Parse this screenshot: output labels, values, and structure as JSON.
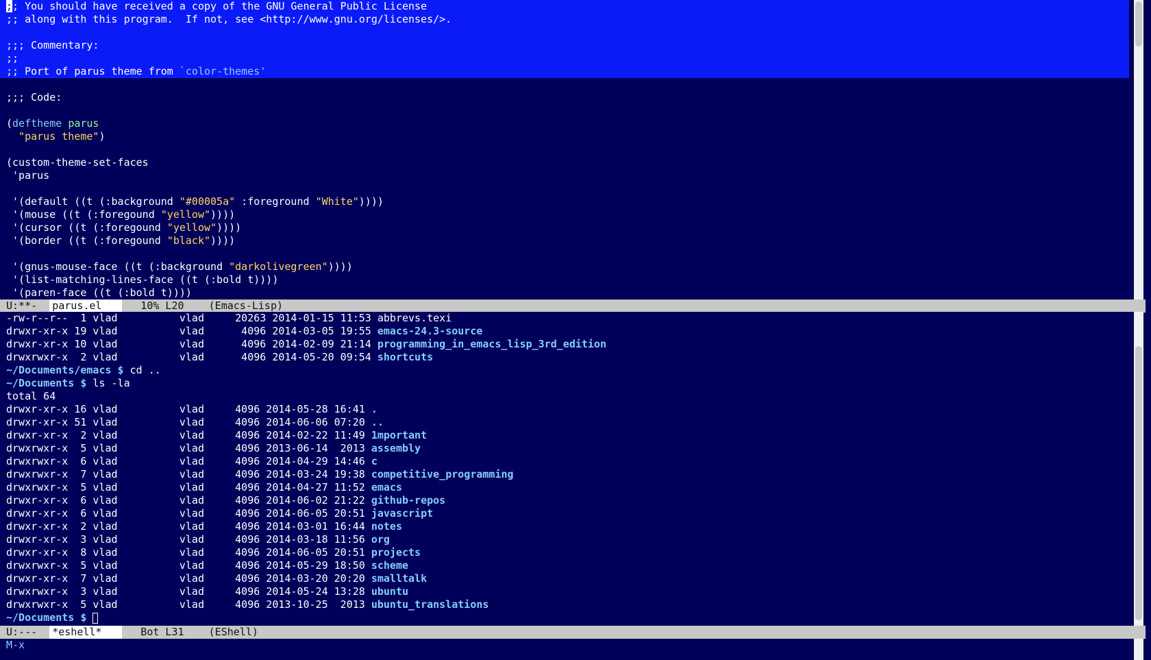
{
  "editor": {
    "comment_lines": [
      ";; You should have received a copy of the GNU General Public License",
      ";; along with this program.  If not, see <http://www.gnu.org/licenses/>.",
      "",
      ";;; Commentary:",
      ";;",
      ";; Port of parus theme from `color-themes'"
    ],
    "code_header": ";;; Code:",
    "deftheme_kw": "deftheme",
    "deftheme_name": "parus",
    "deftheme_doc": "\"parus theme\"",
    "custom_fn": "(custom-theme-set-faces",
    "custom_arg": " 'parus",
    "faces": [
      {
        "prefix": " '(default ((t (:background ",
        "s1": "\"#00005a\"",
        "mid": " :foreground ",
        "s2": "\"White\"",
        "suffix": "))))"
      },
      {
        "prefix": " '(mouse ((t (:foregound ",
        "s1": "\"yellow\"",
        "mid": "",
        "s2": "",
        "suffix": "))))"
      },
      {
        "prefix": " '(cursor ((t (:foregound ",
        "s1": "\"yellow\"",
        "mid": "",
        "s2": "",
        "suffix": "))))"
      },
      {
        "prefix": " '(border ((t (:foregound ",
        "s1": "\"black\"",
        "mid": "",
        "s2": "",
        "suffix": "))))"
      },
      {
        "prefix": "",
        "s1": "",
        "mid": "",
        "s2": "",
        "suffix": ""
      },
      {
        "prefix": " '(gnus-mouse-face ((t (:background ",
        "s1": "\"darkolivegreen\"",
        "mid": "",
        "s2": "",
        "suffix": "))))"
      },
      {
        "prefix": " '(list-matching-lines-face ((t (:bold t))))",
        "s1": "",
        "mid": "",
        "s2": "",
        "suffix": ""
      },
      {
        "prefix": " '(paren-face ((t (:bold t))))",
        "s1": "",
        "mid": "",
        "s2": "",
        "suffix": ""
      }
    ]
  },
  "modeline_top": {
    "status": "U:**-  ",
    "buffer": "parus.el",
    "position": "   10% L20    ",
    "mode": "(Emacs-Lisp)"
  },
  "shell": {
    "prev_listing": [
      {
        "perms": "-rw-r--r--",
        "links": "1",
        "owner": "vlad",
        "group": "vlad",
        "size": "20263",
        "date": "2014-01-15 11:53",
        "name": "abbrevs.texi",
        "is_dir": false
      },
      {
        "perms": "drwxr-xr-x",
        "links": "19",
        "owner": "vlad",
        "group": "vlad",
        "size": "4096",
        "date": "2014-03-05 19:55",
        "name": "emacs-24.3-source",
        "is_dir": true
      },
      {
        "perms": "drwxr-xr-x",
        "links": "10",
        "owner": "vlad",
        "group": "vlad",
        "size": "4096",
        "date": "2014-02-09 21:14",
        "name": "programming_in_emacs_lisp_3rd_edition",
        "is_dir": true
      },
      {
        "perms": "drwxrwxr-x",
        "links": "2",
        "owner": "vlad",
        "group": "vlad",
        "size": "4096",
        "date": "2014-05-20 09:54",
        "name": "shortcuts",
        "is_dir": true
      }
    ],
    "cmd1_prompt": "~/Documents/emacs $",
    "cmd1": " cd ..",
    "cmd2_prompt": "~/Documents $",
    "cmd2": " ls -la",
    "total": "total 64",
    "listing": [
      {
        "perms": "drwxr-xr-x",
        "links": "16",
        "size": "4096",
        "date": "2014-05-28 16:41",
        "name": "."
      },
      {
        "perms": "drwxr-xr-x",
        "links": "51",
        "size": "4096",
        "date": "2014-06-06 07:20",
        "name": ".."
      },
      {
        "perms": "drwxr-xr-x",
        "links": "2",
        "size": "4096",
        "date": "2014-02-22 11:49",
        "name": "1mportant"
      },
      {
        "perms": "drwxrwxr-x",
        "links": "5",
        "size": "4096",
        "date": "2013-06-14  2013",
        "name": "assembly"
      },
      {
        "perms": "drwxrwxr-x",
        "links": "6",
        "size": "4096",
        "date": "2014-04-29 14:46",
        "name": "c"
      },
      {
        "perms": "drwxrwxr-x",
        "links": "7",
        "size": "4096",
        "date": "2014-03-24 19:38",
        "name": "competitive_programming"
      },
      {
        "perms": "drwxrwxr-x",
        "links": "5",
        "size": "4096",
        "date": "2014-04-27 11:52",
        "name": "emacs"
      },
      {
        "perms": "drwxr-xr-x",
        "links": "6",
        "size": "4096",
        "date": "2014-06-02 21:22",
        "name": "github-repos"
      },
      {
        "perms": "drwxr-xr-x",
        "links": "6",
        "size": "4096",
        "date": "2014-06-05 20:51",
        "name": "javascript"
      },
      {
        "perms": "drwxr-xr-x",
        "links": "2",
        "size": "4096",
        "date": "2014-03-01 16:44",
        "name": "notes"
      },
      {
        "perms": "drwxr-xr-x",
        "links": "3",
        "size": "4096",
        "date": "2014-03-18 11:56",
        "name": "org"
      },
      {
        "perms": "drwxr-xr-x",
        "links": "8",
        "size": "4096",
        "date": "2014-06-05 20:51",
        "name": "projects"
      },
      {
        "perms": "drwxrwxr-x",
        "links": "5",
        "size": "4096",
        "date": "2014-05-29 18:50",
        "name": "scheme"
      },
      {
        "perms": "drwxr-xr-x",
        "links": "7",
        "size": "4096",
        "date": "2014-03-20 20:20",
        "name": "smalltalk"
      },
      {
        "perms": "drwxrwxr-x",
        "links": "3",
        "size": "4096",
        "date": "2014-05-24 13:28",
        "name": "ubuntu"
      },
      {
        "perms": "drwxrwxr-x",
        "links": "5",
        "size": "4096",
        "date": "2013-10-25  2013",
        "name": "ubuntu_translations"
      }
    ],
    "owner": "vlad",
    "group": "vlad",
    "final_prompt": "~/Documents $"
  },
  "modeline_bottom": {
    "status": "U:---  ",
    "buffer": "*eshell*",
    "position": "   Bot L31    ",
    "mode": "(EShell)"
  },
  "minibuffer": {
    "text": "M-x"
  },
  "colors": {
    "background": "#00005a",
    "region": "#0b1bf7",
    "string": "#ffd75f",
    "keyword": "#87cefa",
    "function": "#98fb98",
    "modeline": "#c8c8c8"
  }
}
